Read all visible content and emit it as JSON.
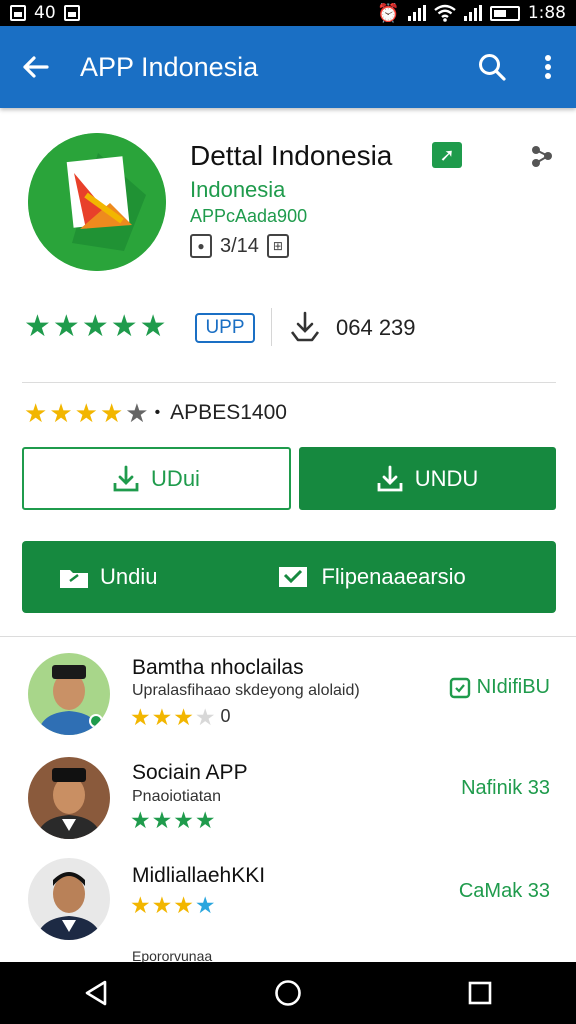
{
  "status_bar": {
    "left_text": "40",
    "time": "1:88"
  },
  "app_bar": {
    "title": "APP Indonesia"
  },
  "app": {
    "name": "Dettal Indonesia",
    "developer": "Indonesia",
    "category": "APPcAada900",
    "meta_value": "3/14"
  },
  "stats": {
    "upp_label": "UPP",
    "downloads": "064 239"
  },
  "rating": {
    "stars": 4,
    "text": "APBES1400"
  },
  "buttons": {
    "outline_label": "UDui",
    "filled_label": "UNDU",
    "wide_left_label": "Undiu",
    "wide_right_label": "Flipenaaearsio"
  },
  "reviews": [
    {
      "name": "Bamtha nhoclailas",
      "subtitle": "Upralasfihaao skdeyong alolaid)",
      "stars": 3,
      "count": "0",
      "action": "NIdifiBU",
      "star_color": "gold"
    },
    {
      "name": "Sociain APP",
      "subtitle": "Pnaoiotiatan",
      "stars": 4,
      "count": "",
      "action": "Nafinik 33",
      "star_color": "green"
    },
    {
      "name": "MidliallaehKKI",
      "subtitle": "",
      "stars": 4,
      "count": "",
      "action": "CaMak 33",
      "star_color": "gold_blue"
    }
  ],
  "peek_text": "Epororvunaa",
  "colors": {
    "primary": "#1a6fc4",
    "accent": "#16893f",
    "star_gold": "#f2b600"
  }
}
